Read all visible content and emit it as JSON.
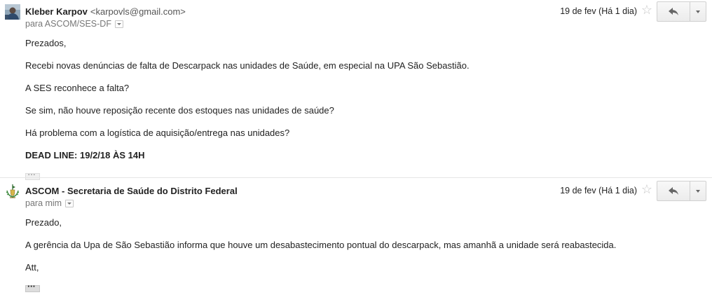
{
  "messages": [
    {
      "sender_name": "Kleber Karpov",
      "sender_email": "<karpovls@gmail.com>",
      "recipients": "para ASCOM/SES-DF",
      "date": "19 de fev (Há 1 dia)",
      "avatar": "user-photo",
      "paragraphs": [
        "Prezados,",
        "Recebi novas denúncias de falta de Descarpack nas unidades de Saúde, em especial na UPA São Sebastião.",
        "A SES reconhece a falta?",
        "Se sim, não houve reposição recente dos estoques nas unidades de saúde?",
        "Há problema com a logística de aquisição/entrega nas unidades?",
        "DEAD LINE: 19/2/18 ÀS 14H"
      ]
    },
    {
      "sender_name": "ASCOM - Secretaria de Saúde do Distrito Federal",
      "recipients": "para mim",
      "date": "19 de fev (Há 1 dia)",
      "avatar": "df-coat-of-arms",
      "paragraphs": [
        "Prezado,",
        "A gerência da Upa de São Sebastião informa que houve um desabastecimento pontual do descarpack, mas amanhã a unidade será reabastecida.",
        "Att,"
      ]
    }
  ],
  "icons": {
    "star": "star-outline-icon",
    "reply": "reply-arrow-icon",
    "more": "chevron-down-icon",
    "trimmed": "ellipsis-icon"
  },
  "colors": {
    "text": "#222222",
    "secondary": "#777777",
    "star": "#c6c6c6",
    "divider": "#e5e5e5"
  }
}
